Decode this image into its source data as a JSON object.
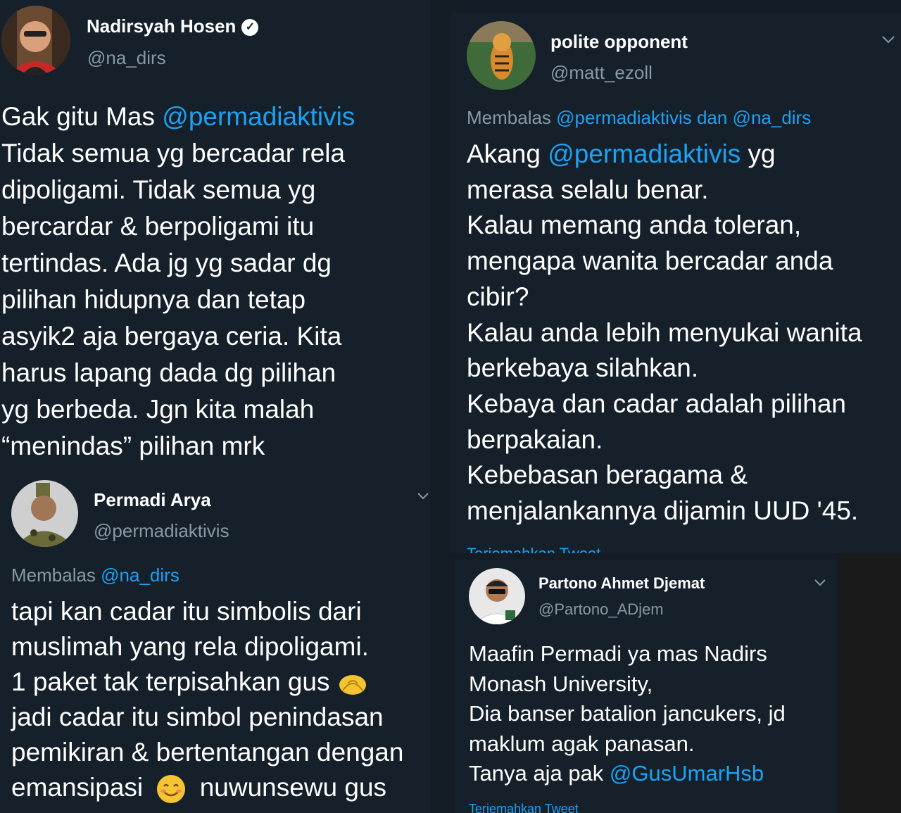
{
  "tweet1": {
    "name": "Nadirsyah Hosen",
    "handle": "@na_dirs",
    "mention": "@permadiaktivis",
    "text_prefix": "Gak gitu Mas ",
    "lines": [
      "Tidak semua yg bercadar rela",
      "dipoligami. Tidak semua yg",
      "bercardar & berpoligami itu",
      "tertindas. Ada jg yg sadar dg",
      "pilihan hidupnya dan tetap",
      "asyik2 aja bergaya ceria. Kita",
      "harus lapang dada dg pilihan",
      "yg berbeda. Jgn kita malah",
      "“menindas” pilihan mrk"
    ]
  },
  "tweet2": {
    "name": "Permadi Arya",
    "handle": "@permadiaktivis",
    "reply_prefix": "Membalas ",
    "reply_mention": "@na_dirs",
    "lines": [
      "tapi kan cadar itu simbolis dari",
      "muslimah yang rela dipoligami.",
      "1 paket tak terpisahkan gus",
      "jadi cadar itu simbol penindasan",
      "pemikiran & bertentangan dengan",
      "emansipasi",
      "nuwunsewu gus"
    ]
  },
  "tweet3": {
    "name": "polite opponent",
    "handle": "@matt_ezoll",
    "reply_prefix": "Membalas ",
    "reply_mentions": "@permadiaktivis dan @na_dirs",
    "first_prefix": "Akang ",
    "first_mention": "@permadiaktivis",
    "first_suffix": " yg",
    "lines": [
      "merasa selalu benar.",
      "Kalau memang anda toleran,",
      "mengapa wanita bercadar anda",
      "cibir?",
      "Kalau anda lebih menyukai wanita",
      "berkebaya silahkan.",
      "Kebaya dan cadar adalah pilihan",
      "berpakaian.",
      "Kebebasan beragama &",
      "menjalankannya dijamin UUD '45."
    ],
    "translate": "Terjemahkan Tweet"
  },
  "tweet4": {
    "name": "Partono Ahmet Djemat",
    "handle": "@Partono_ADjem",
    "lines": [
      "Maafin Permadi ya mas Nadirs",
      "Monash University,",
      "Dia banser batalion jancukers, jd",
      "maklum agak panasan."
    ],
    "last_prefix": "Tanya aja pak ",
    "last_mention": "@GusUmarHsb",
    "translate": "Terjemahkan Tweet"
  },
  "colors": {
    "background": "#15202b",
    "link": "#1da1f2",
    "secondary_text": "#8899a6"
  }
}
